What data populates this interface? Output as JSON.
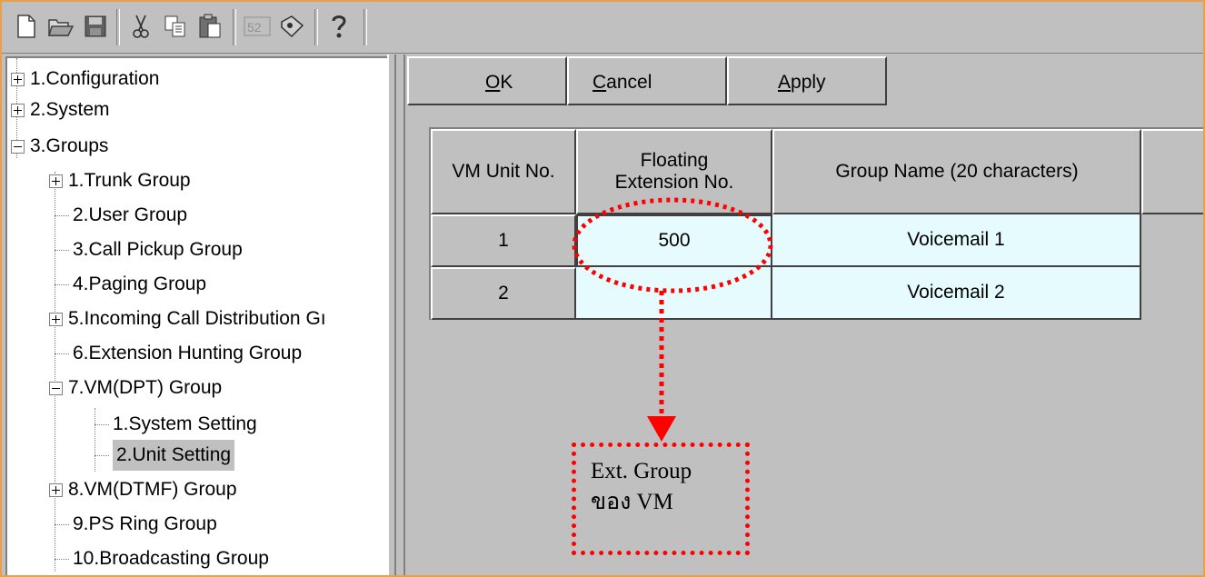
{
  "toolbar": {
    "icons": [
      "new-file-icon",
      "open-folder-icon",
      "save-icon",
      "cut-icon",
      "copy-icon",
      "paste-icon",
      "chart-icon",
      "tools-icon",
      "help-icon"
    ]
  },
  "tree": {
    "items": [
      {
        "label": "1.Configuration",
        "toggle": "+"
      },
      {
        "label": "2.System",
        "toggle": "+"
      },
      {
        "label": "3.Groups",
        "toggle": "-"
      },
      {
        "label": "1.Trunk Group",
        "toggle": "+"
      },
      {
        "label": "2.User Group"
      },
      {
        "label": "3.Call Pickup Group"
      },
      {
        "label": "4.Paging Group"
      },
      {
        "label": "5.Incoming Call Distribution Gı",
        "toggle": "+"
      },
      {
        "label": "6.Extension Hunting Group"
      },
      {
        "label": "7.VM(DPT) Group",
        "toggle": "-"
      },
      {
        "label": "1.System Setting"
      },
      {
        "label": "2.Unit Setting",
        "selected": true
      },
      {
        "label": "8.VM(DTMF) Group",
        "toggle": "+"
      },
      {
        "label": "9.PS Ring Group"
      },
      {
        "label": "10.Broadcasting Group"
      }
    ]
  },
  "buttons": {
    "ok": {
      "label": "OK",
      "mnemonic": "O",
      "rest": "K"
    },
    "cancel": {
      "label": "Cancel",
      "mnemonic": "C",
      "rest": "ancel"
    },
    "apply": {
      "label": "Apply",
      "mnemonic": "A",
      "rest": "pply"
    }
  },
  "table": {
    "columns": [
      "VM Unit No.",
      "Floating Extension No.",
      "Group Name (20 characters)"
    ],
    "column_lines": [
      [
        "VM Unit No."
      ],
      [
        "Floating",
        "Extension No."
      ],
      [
        "Group Name (20 characters)"
      ]
    ],
    "rows": [
      {
        "unit": "1",
        "extension": "500",
        "group_name": "Voicemail 1"
      },
      {
        "unit": "2",
        "extension": "",
        "group_name": "Voicemail 2"
      }
    ]
  },
  "annotation": {
    "line1": "Ext. Group",
    "line2": "ของ VM",
    "color": "#ff0000"
  },
  "colors": {
    "frame_border": "#e8a050",
    "panel_bg": "#c0c0c0",
    "cell_bg": "#e6fbfd",
    "annotation": "#ff0000"
  }
}
